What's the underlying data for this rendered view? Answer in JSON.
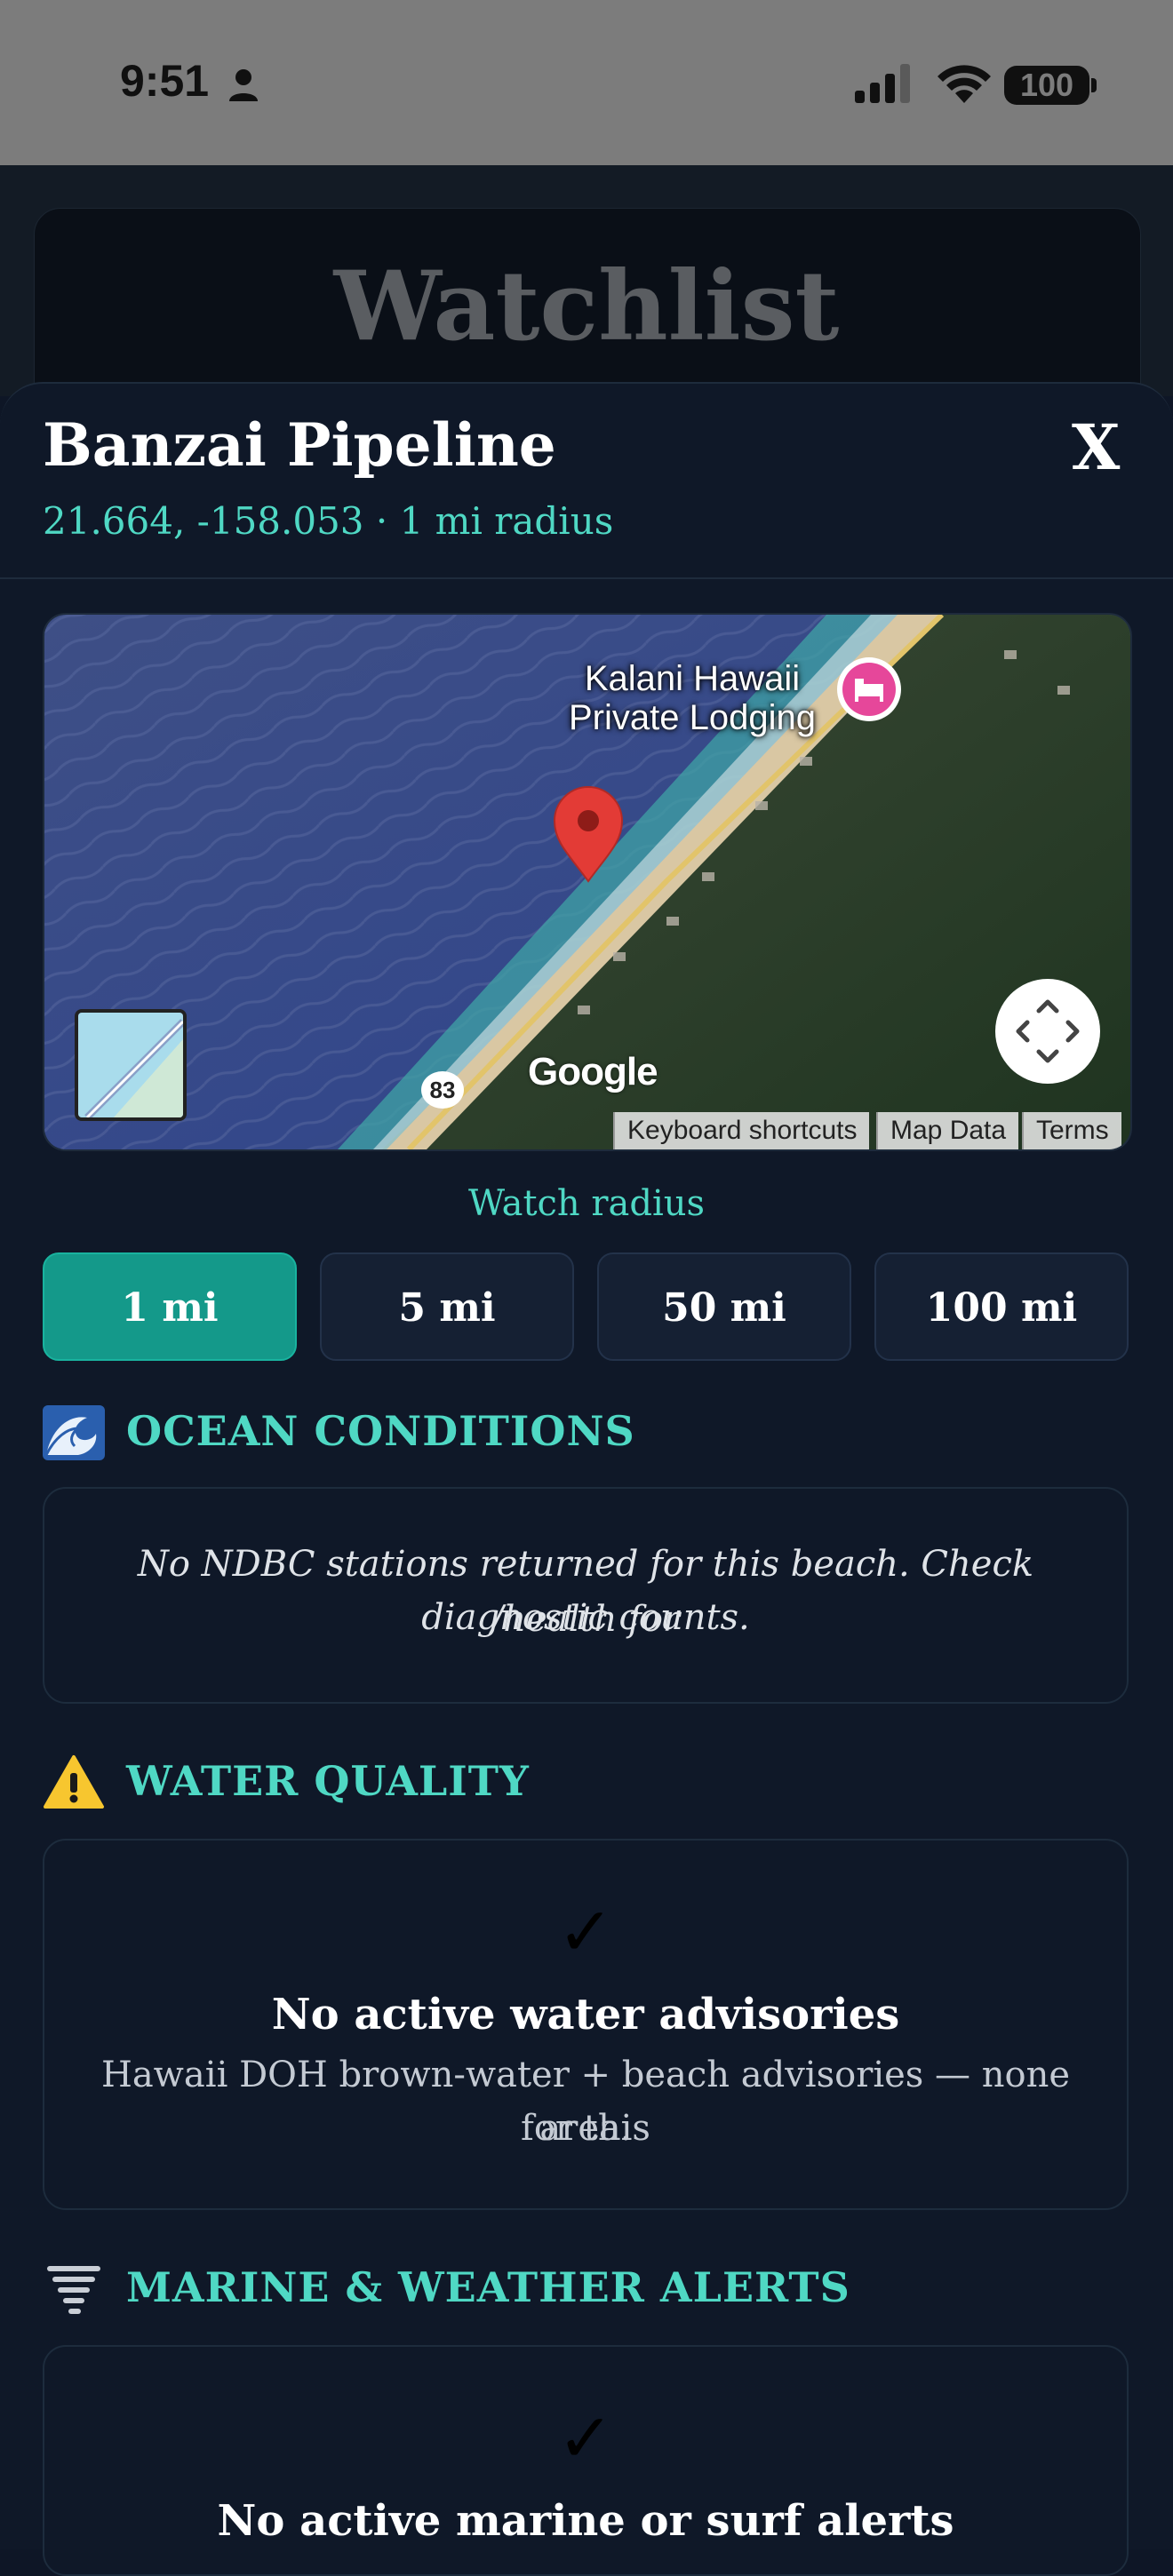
{
  "status_bar": {
    "time": "9:51",
    "battery": "100"
  },
  "background_page": {
    "title": "Watchlist"
  },
  "sheet": {
    "title": "Banzai Pipeline",
    "close_label": "X",
    "subtitle": "21.664, -158.053 · 1 mi radius"
  },
  "map": {
    "poi_name_line1": "Kalani Hawaii",
    "poi_name_line2": "Private Lodging",
    "route_number": "83",
    "logo": "Google",
    "attribution": [
      "Keyboard shortcuts",
      "Map Data",
      "Terms"
    ],
    "marker_icon": "map-pin-icon",
    "poi_icon": "bed-icon"
  },
  "radius": {
    "label": "Watch radius",
    "options": [
      "1 mi",
      "5 mi",
      "50 mi",
      "100 mi"
    ],
    "selected": "1 mi"
  },
  "ocean": {
    "icon": "wave-icon",
    "title": "OCEAN CONDITIONS",
    "message_line1": "No NDBC stations returned for this beach. Check /health for",
    "message_line2": "diagnostic counts."
  },
  "water": {
    "icon": "warning-icon",
    "title": "WATER QUALITY",
    "check": "✓",
    "heading": "No active water advisories",
    "detail_line1": "Hawaii DOH brown-water + beach advisories — none for this",
    "detail_line2": "area."
  },
  "alerts": {
    "icon": "tornado-icon",
    "title": "MARINE & WEATHER ALERTS",
    "check": "✓",
    "heading": "No active marine or surf alerts"
  },
  "colors": {
    "accent": "#4fd8c4",
    "active_button": "#14998a",
    "background": "#0f1828"
  }
}
